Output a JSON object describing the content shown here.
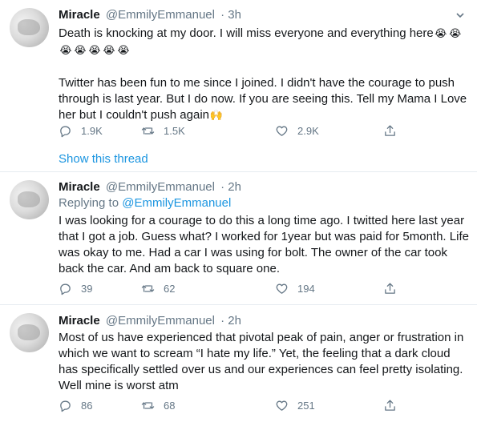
{
  "tweets": [
    {
      "name": "Miracle",
      "handle": "@EmmilyEmmanuel",
      "time": "· 3h",
      "reply_prefix": "",
      "reply_handle": "",
      "paragraph1": "Death is knocking at my door. I will miss everyone and everything here",
      "emojis": [
        "😭",
        "😭",
        "😭",
        "😭",
        "😭",
        "😭",
        "😭"
      ],
      "paragraph2": "Twitter has been fun to me since I joined. I didn't have the courage to push through is last year. But I do now. If you are seeing this. Tell my Mama I Love her but I couldn't push again",
      "trailing_emoji": "🙌",
      "replies": "1.9K",
      "retweets": "1.5K",
      "likes": "2.9K"
    },
    {
      "name": "Miracle",
      "handle": "@EmmilyEmmanuel",
      "time": "· 2h",
      "reply_prefix": "Replying to ",
      "reply_handle": "@EmmilyEmmanuel",
      "text": "I was looking for a courage to do this a long time ago. I twitted here last year that I got a job. Guess what? I worked for 1year but was paid for 5month. Life was okay to me. Had a car I was using for bolt. The owner of the car took back the car. And am back to square one.",
      "replies": "39",
      "retweets": "62",
      "likes": "194"
    },
    {
      "name": "Miracle",
      "handle": "@EmmilyEmmanuel",
      "time": "· 2h",
      "text": "Most of us have experienced that pivotal peak of pain, anger or frustration in which we want to scream “I hate my life.” Yet, the feeling that a dark cloud has specifically settled over us and our experiences can feel pretty isolating. Well mine is worst atm",
      "replies": "86",
      "retweets": "68",
      "likes": "251"
    }
  ],
  "show_thread_label": "Show this thread",
  "icons": {
    "reply": "reply-icon",
    "retweet": "retweet-icon",
    "like": "heart-icon",
    "share": "share-icon",
    "more": "chevron-down-icon"
  },
  "colors": {
    "link": "#1b95e0",
    "secondary_text": "#657786",
    "divider": "#e6ecf0"
  }
}
